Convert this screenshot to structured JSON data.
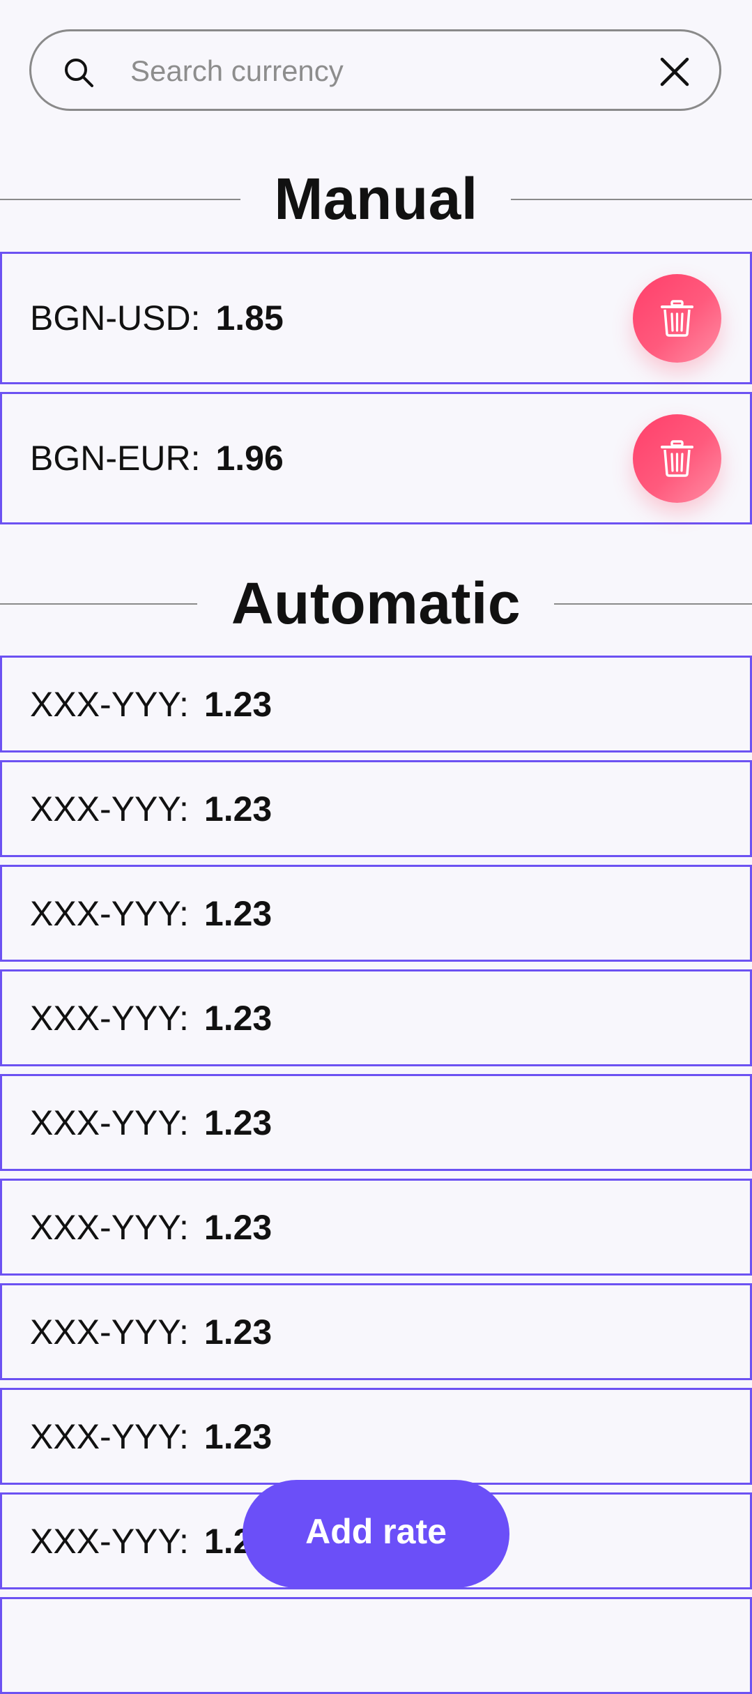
{
  "search": {
    "placeholder": "Search currency",
    "value": ""
  },
  "manual": {
    "title": "Manual",
    "items": [
      {
        "pair": "BGN-USD:",
        "rate": "1.85"
      },
      {
        "pair": "BGN-EUR:",
        "rate": "1.96"
      }
    ]
  },
  "automatic": {
    "title": "Automatic",
    "items": [
      {
        "pair": "XXX-YYY:",
        "rate": "1.23"
      },
      {
        "pair": "XXX-YYY:",
        "rate": "1.23"
      },
      {
        "pair": "XXX-YYY:",
        "rate": "1.23"
      },
      {
        "pair": "XXX-YYY:",
        "rate": "1.23"
      },
      {
        "pair": "XXX-YYY:",
        "rate": "1.23"
      },
      {
        "pair": "XXX-YYY:",
        "rate": "1.23"
      },
      {
        "pair": "XXX-YYY:",
        "rate": "1.23"
      },
      {
        "pair": "XXX-YYY:",
        "rate": "1.23"
      },
      {
        "pair": "XXX-YYY:",
        "rate": "1.23"
      },
      {
        "pair": "",
        "rate": ""
      }
    ]
  },
  "add_button": {
    "label": "Add rate"
  },
  "icons": {
    "search": "search-icon",
    "clear": "close-icon",
    "delete": "trash-icon"
  },
  "colors": {
    "accent": "#6b4ff8",
    "row_border": "#6c52f2",
    "delete": "#ff4f73",
    "background": "#f8f7fc"
  }
}
